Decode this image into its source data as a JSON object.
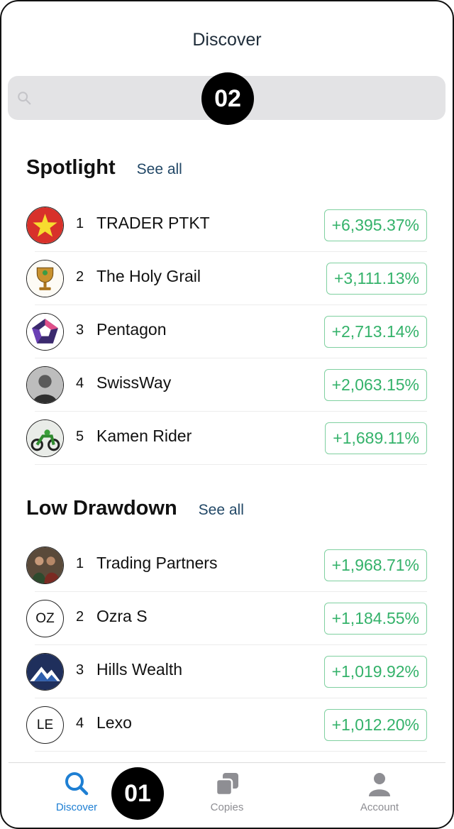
{
  "header": {
    "title": "Discover"
  },
  "search": {
    "placeholder": "",
    "value": ""
  },
  "markers": {
    "top": "02",
    "bottom": "01"
  },
  "spotlight": {
    "title": "Spotlight",
    "see_all": "See all",
    "items": [
      {
        "rank": "1",
        "name": "TRADER PTKT",
        "change": "+6,395.37%",
        "avatar": "star-flag-icon"
      },
      {
        "rank": "2",
        "name": "The Holy Grail",
        "change": "+3,111.13%",
        "avatar": "trophy-icon"
      },
      {
        "rank": "3",
        "name": "Pentagon",
        "change": "+2,713.14%",
        "avatar": "pentagon-logo-icon"
      },
      {
        "rank": "4",
        "name": "SwissWay",
        "change": "+2,063.15%",
        "avatar": "person-photo-icon"
      },
      {
        "rank": "5",
        "name": "Kamen Rider",
        "change": "+1,689.11%",
        "avatar": "motorcycle-icon"
      }
    ]
  },
  "low_drawdown": {
    "title": "Low Drawdown",
    "see_all": "See all",
    "items": [
      {
        "rank": "1",
        "name": "Trading Partners",
        "change": "+1,968.71%",
        "avatar": "group-photo-icon"
      },
      {
        "rank": "2",
        "name": "Ozra S",
        "change": "+1,184.55%",
        "initials": "OZ"
      },
      {
        "rank": "3",
        "name": "Hills Wealth",
        "change": "+1,019.92%",
        "avatar": "mountain-logo-icon"
      },
      {
        "rank": "4",
        "name": "Lexo",
        "change": "+1,012.20%",
        "initials": "LE"
      }
    ]
  },
  "tabs": [
    {
      "label": "Discover",
      "icon": "search-icon",
      "active": true
    },
    {
      "label": "Copies",
      "icon": "copies-icon",
      "active": false
    },
    {
      "label": "Account",
      "icon": "person-icon",
      "active": false
    }
  ],
  "colors": {
    "accent": "#1e7fd3",
    "gain": "#34b26a",
    "gain_border": "#7fd0a0"
  }
}
